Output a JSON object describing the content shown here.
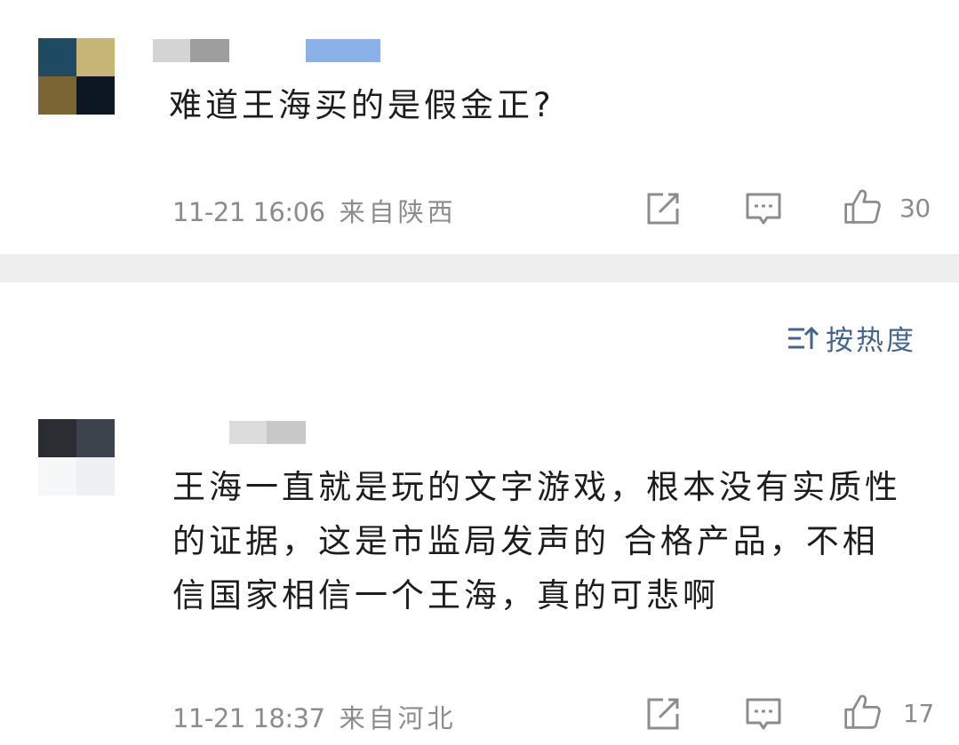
{
  "sort": {
    "label": "按热度",
    "color": "#44648e",
    "icon": "sort-desc-icon"
  },
  "comments": [
    {
      "text": "难道王海买的是假金正?",
      "time": "11-21 16:06",
      "location": "来自陕西",
      "likes": "30",
      "avatar_colors": [
        "#1f4b62",
        "#c6b574",
        "#7c6535",
        "#0d1722"
      ],
      "username_blurred": true
    },
    {
      "text": "王海一直就是玩的文字游戏，根本没有实质性的证据，这是市监局发声的 合格产品，不相信国家相信一个王海，真的可悲啊",
      "time": "11-21 18:37",
      "location": "来自河北",
      "likes": "17",
      "avatar_colors": [
        "#2a2e33",
        "#3d434c",
        "#f6f7f8",
        "#eef0f3"
      ],
      "username_blurred": true
    }
  ],
  "icons": {
    "share": "share-icon",
    "reply": "comment-icon",
    "like": "thumbs-up-icon"
  },
  "colors": {
    "text": "#1d1d1d",
    "meta": "#8c8c8c",
    "divider": "#eeeeee"
  }
}
